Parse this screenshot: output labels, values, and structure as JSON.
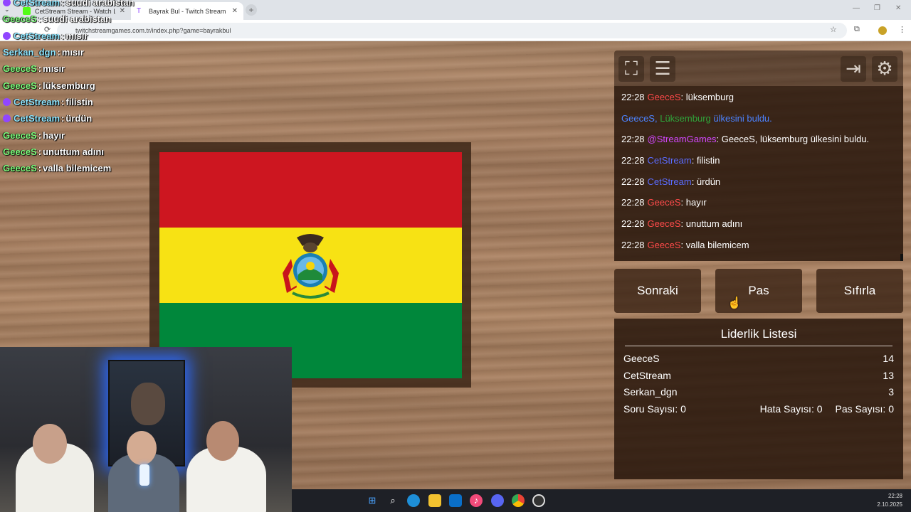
{
  "browser": {
    "tabs": [
      {
        "title": "CetStream Stream - Watch Live",
        "favicon_color": "#53fc18"
      },
      {
        "title": "Bayrak Bul - Twitch Stream Games",
        "favicon_color": "#9146ff"
      }
    ],
    "new_tab_label": "+",
    "url": "twitchstreamgames.com.tr/index.php?game=bayrakbul",
    "tab_dropdown": "⌄"
  },
  "overlay_chat": [
    {
      "user": "CetStream",
      "message": "suudi arabistan",
      "user_color": "#8ee6ff",
      "badge": true
    },
    {
      "user": "GeeceS",
      "message": "suudi arabistan",
      "user_color": "#7cfc7c",
      "badge": false
    },
    {
      "user": "CetStream",
      "message": "mısır",
      "user_color": "#8ee6ff",
      "badge": true
    },
    {
      "user": "Serkan_dgn",
      "message": "mısır",
      "user_color": "#8ee6ff",
      "badge": false
    },
    {
      "user": "GeeceS",
      "message": "mısır",
      "user_color": "#7cfc7c",
      "badge": false
    },
    {
      "user": "GeeceS",
      "message": "lüksemburg",
      "user_color": "#7cfc7c",
      "badge": false
    },
    {
      "user": "CetStream",
      "message": "filistin",
      "user_color": "#8ee6ff",
      "badge": true
    },
    {
      "user": "CetStream",
      "message": "ürdün",
      "user_color": "#8ee6ff",
      "badge": true
    },
    {
      "user": "GeeceS",
      "message": "hayır",
      "user_color": "#7cfc7c",
      "badge": false
    },
    {
      "user": "GeeceS",
      "message": "unuttum adını",
      "user_color": "#7cfc7c",
      "badge": false
    },
    {
      "user": "GeeceS",
      "message": "valla bilemicem",
      "user_color": "#7cfc7c",
      "badge": false
    }
  ],
  "flag": {
    "country_emblem": "bolivia-coat-of-arms-icon",
    "stripes": [
      "#cd1620",
      "#f7e214",
      "#00873b"
    ]
  },
  "toolbar": {
    "fullscreen_icon": "fullscreen-icon",
    "notes_icon": "notes-icon",
    "exit_icon": "exit-icon",
    "settings_icon": "settings-icon"
  },
  "game_chat": [
    {
      "time": "22:28",
      "user": "GeeceS",
      "text": ": lüksemburg",
      "type": "msg",
      "color": "red"
    },
    {
      "type": "system",
      "user": "GeeceS,",
      "country": "Lüksemburg",
      "suffix": "ülkesini buldu."
    },
    {
      "time": "22:28",
      "user": "@StreamGames",
      "text": ": GeeceS, lüksemburg ülkesini buldu.",
      "type": "msg",
      "color": "mag"
    },
    {
      "time": "22:28",
      "user": "CetStream",
      "text": ": filistin",
      "type": "msg",
      "color": "blue"
    },
    {
      "time": "22:28",
      "user": "CetStream",
      "text": ": ürdün",
      "type": "msg",
      "color": "blue"
    },
    {
      "time": "22:28",
      "user": "GeeceS",
      "text": ": hayır",
      "type": "msg",
      "color": "red"
    },
    {
      "time": "22:28",
      "user": "GeeceS",
      "text": ": unuttum adını",
      "type": "msg",
      "color": "red"
    },
    {
      "time": "22:28",
      "user": "GeeceS",
      "text": ": valla bilemicem",
      "type": "msg",
      "color": "red"
    }
  ],
  "buttons": {
    "next": "Sonraki",
    "pass": "Pas",
    "reset": "Sıfırla"
  },
  "leaderboard": {
    "title": "Liderlik Listesi",
    "rows": [
      {
        "name": "GeeceS",
        "score": "14"
      },
      {
        "name": "CetStream",
        "score": "13"
      },
      {
        "name": "Serkan_dgn",
        "score": "3"
      }
    ],
    "question_count": "Soru Sayısı: 0",
    "error_count": "Hata Sayısı: 0",
    "pass_count": "Pas Sayısı: 0"
  },
  "taskbar": {
    "icons": [
      "windows-start-icon",
      "search-icon",
      "edge-icon",
      "file-explorer-icon",
      "outlook-icon",
      "music-icon",
      "discord-icon",
      "chrome-icon",
      "obs-icon"
    ],
    "time": "22:28",
    "date": "2.10.2025"
  }
}
